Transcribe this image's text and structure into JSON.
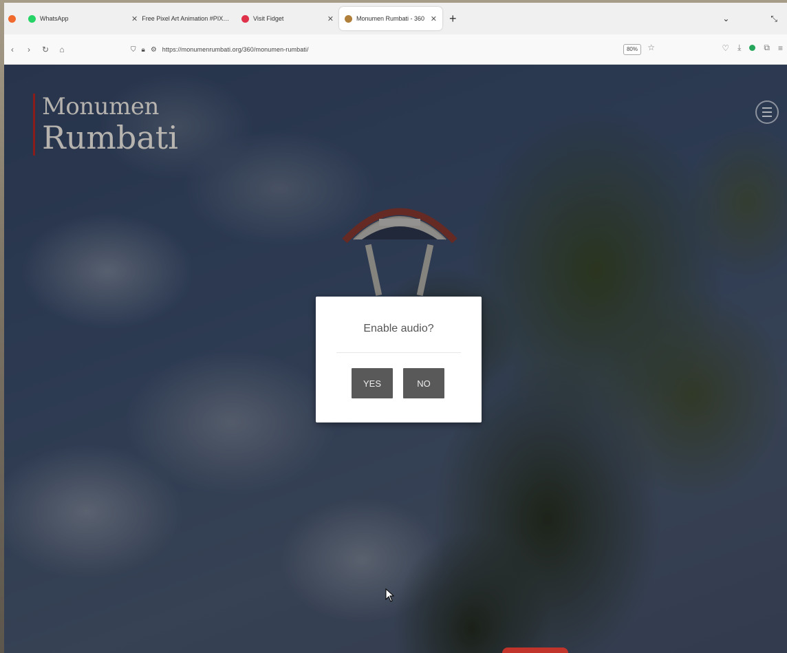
{
  "browser": {
    "tabs": [
      {
        "label": "WhatsApp",
        "active": false,
        "icon_color": "#25d366"
      },
      {
        "label": "Free Pixel Art Animation #PIXEL ART",
        "active": false,
        "icon_color": "#999999"
      },
      {
        "label": "Visit Fidget",
        "active": false,
        "icon_color": "#e0314b"
      },
      {
        "label": "Monumen Rumbati - 360",
        "active": true,
        "icon_color": "#b0803a"
      }
    ],
    "new_tab_label": "+",
    "url": "https://monumenrumbati.org/360/monumen-rumbati/",
    "zoom": "80%"
  },
  "site": {
    "logo_line1": "Monumen",
    "logo_line2": "Rumbati",
    "accent_color": "#8b1c1c"
  },
  "dialog": {
    "message": "Enable audio?",
    "yes_label": "YES",
    "no_label": "NO"
  }
}
